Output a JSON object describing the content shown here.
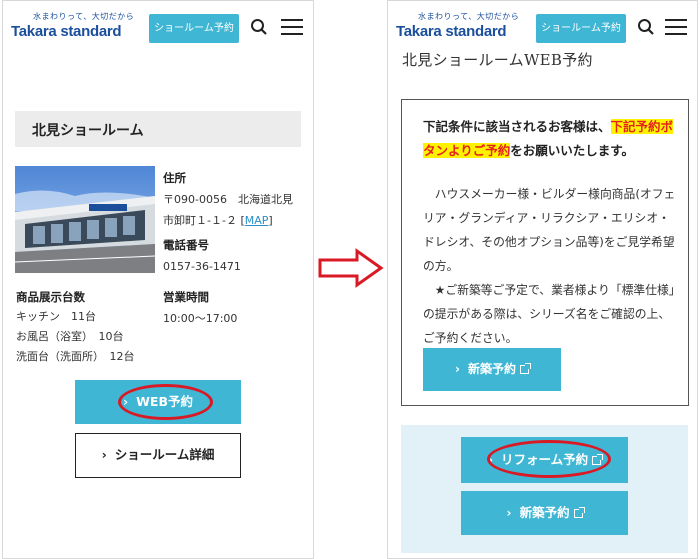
{
  "brand": {
    "tagline": "水まわりって、大切だから",
    "name": "Takara standard"
  },
  "header": {
    "reserve_label": "ショールーム予約",
    "search_icon": "search-icon",
    "menu_icon": "hamburger-menu-icon"
  },
  "left": {
    "showroom_name": "北見ショールーム",
    "photo_sign": "タカラ スタンダード",
    "address_heading": "住所",
    "address_line1": "〒090-0056　北海道北見",
    "address_line2": "市卸町１-１-２",
    "map_label": "MAP",
    "phone_heading": "電話番号",
    "phone": "0157-36-1471",
    "exhibit_heading": "商品展示台数",
    "exhibits": [
      "キッチン　11台",
      "お風呂（浴室）　10台",
      "洗面台（洗面所）　12台"
    ],
    "hours_heading": "営業時間",
    "hours": "10:00～17:00",
    "web_reserve_label": "WEB予約",
    "detail_label": "ショールーム詳細"
  },
  "right": {
    "page_title": "北見ショールームWEB予約",
    "lead_before": "下記条件に該当されるお客様は、",
    "lead_highlight": "下記予約ボタンよりご予約",
    "lead_after": "をお願いいたします。",
    "body_para1": "ハウスメーカー様・ビルダー様向商品(オフェリア・グランディア・リラクシア・エリシオ・ドレシオ、その他オプション品等)をご見学希望の方。",
    "body_para2": "★ご新築等ご予定で、業者様より「標準仕様」の提示がある際は、シリーズ名をご確認の上、ご予約ください。",
    "new_build_label": "新築予約",
    "reform_label": "リフォーム予約",
    "new_build_label2": "新築予約"
  },
  "colors": {
    "accent": "#3fb6d4",
    "brand": "#1b4f9c",
    "highlight_bg": "#fff200",
    "highlight_text": "#e4231e",
    "annotation_red": "#d91a24",
    "panel_bg": "#e2f1f8"
  }
}
